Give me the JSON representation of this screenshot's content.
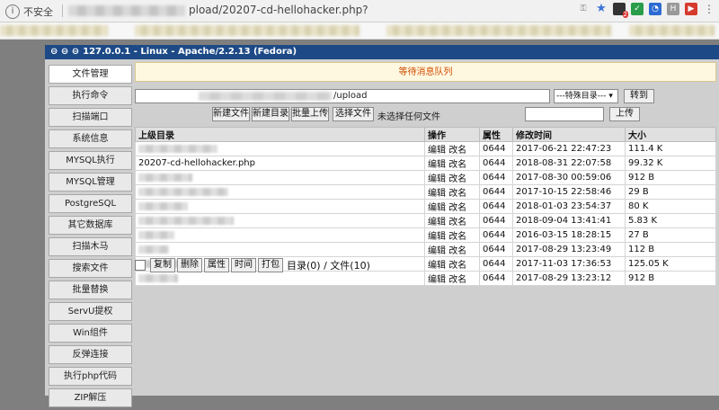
{
  "browser": {
    "insecure_label": "不安全",
    "url_tail": "pload/20207-cd-hellohacker.php?",
    "icon_names": [
      "info-icon",
      "key-icon",
      "star-icon",
      "extension-icon",
      "shield-icon",
      "history-icon",
      "video-icon",
      "menu-icon"
    ]
  },
  "window": {
    "title": "127.0.0.1 - Linux - Apache/2.2.13 (Fedora)",
    "title_dots": "⊖ ⊖ ⊖"
  },
  "sidebar": {
    "items": [
      {
        "label": "文件管理"
      },
      {
        "label": "执行命令"
      },
      {
        "label": "扫描端口"
      },
      {
        "label": "系统信息"
      },
      {
        "label": "MYSQL执行"
      },
      {
        "label": "MYSQL管理"
      },
      {
        "label": "PostgreSQL"
      },
      {
        "label": "其它数据库"
      },
      {
        "label": "扫描木马"
      },
      {
        "label": "搜索文件"
      },
      {
        "label": "批量替换"
      },
      {
        "label": "ServU提权"
      },
      {
        "label": "Win组件"
      },
      {
        "label": "反弹连接"
      },
      {
        "label": "执行php代码"
      },
      {
        "label": "ZIP解压"
      }
    ]
  },
  "main": {
    "notice": "等待消息队列",
    "path_value": "/upload",
    "special_dir_select": "---特殊目录---",
    "goto_button": "转到",
    "buttons": {
      "new_file": "新建文件",
      "new_dir": "新建目录",
      "batch_upload": "批量上传",
      "choose_file": "选择文件",
      "no_file_chosen": "未选择任何文件",
      "upload": "上传"
    },
    "table": {
      "headers": [
        "上级目录",
        "操作",
        "属性",
        "修改时间",
        "大小"
      ],
      "rows": [
        {
          "name": "",
          "action_edit": "编辑",
          "action_rename": "改名",
          "perm": "0644",
          "mtime": "2017-06-21 22:47:23",
          "size": "111.4 K"
        },
        {
          "name": "20207-cd-hellohacker.php",
          "action_edit": "编辑",
          "action_rename": "改名",
          "perm": "0644",
          "mtime": "2018-08-31 22:07:58",
          "size": "99.32 K"
        },
        {
          "name": "",
          "action_edit": "编辑",
          "action_rename": "改名",
          "perm": "0644",
          "mtime": "2017-08-30 00:59:06",
          "size": "912 B"
        },
        {
          "name": "",
          "action_edit": "编辑",
          "action_rename": "改名",
          "perm": "0644",
          "mtime": "2017-10-15 22:58:46",
          "size": "29 B"
        },
        {
          "name": "",
          "action_edit": "编辑",
          "action_rename": "改名",
          "perm": "0644",
          "mtime": "2018-01-03 23:54:37",
          "size": "80 K"
        },
        {
          "name": "",
          "action_edit": "编辑",
          "action_rename": "改名",
          "perm": "0644",
          "mtime": "2018-09-04 13:41:41",
          "size": "5.83 K"
        },
        {
          "name": "",
          "action_edit": "编辑",
          "action_rename": "改名",
          "perm": "0644",
          "mtime": "2016-03-15 18:28:15",
          "size": "27 B"
        },
        {
          "name": "",
          "action_edit": "编辑",
          "action_rename": "改名",
          "perm": "0644",
          "mtime": "2017-08-29 13:23:49",
          "size": "112 B"
        },
        {
          "name": "",
          "action_edit": "编辑",
          "action_rename": "改名",
          "perm": "0644",
          "mtime": "2017-11-03 17:36:53",
          "size": "125.05 K"
        },
        {
          "name": "",
          "action_edit": "编辑",
          "action_rename": "改名",
          "perm": "0644",
          "mtime": "2017-08-29 13:23:12",
          "size": "912 B"
        }
      ]
    },
    "bottom": {
      "copy": "复制",
      "delete": "删除",
      "attr": "属性",
      "time": "时间",
      "pack": "打包",
      "summary": "目录(0) / 文件(10)"
    }
  }
}
